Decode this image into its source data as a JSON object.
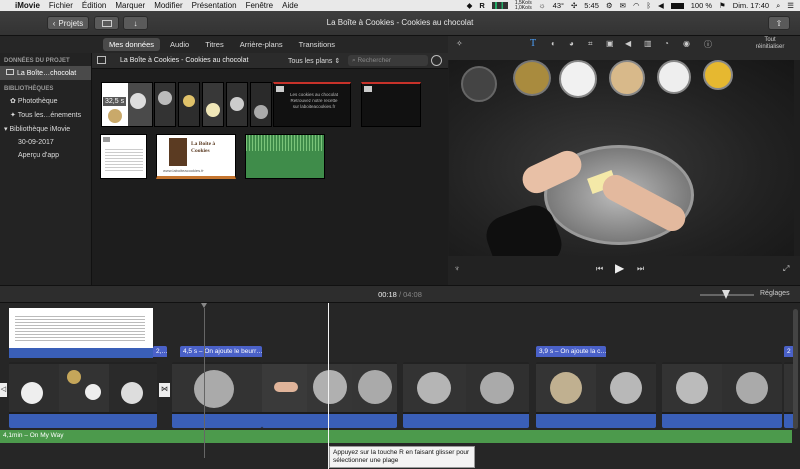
{
  "menubar": {
    "items": [
      "iMovie",
      "Fichier",
      "Édition",
      "Marquer",
      "Modifier",
      "Présentation",
      "Fenêtre",
      "Aide"
    ],
    "net_up": "1,5Ko/s",
    "net_down": "1,0Ko/s",
    "temp": "43°",
    "time": "5:45",
    "battery": "100 %",
    "clock": "Dim. 17:40"
  },
  "toolbar": {
    "projects_label": "Projets",
    "window_title": "La Boîte à Cookies - Cookies au chocolat"
  },
  "tabs": [
    {
      "label": "Mes données",
      "active": true
    },
    {
      "label": "Audio",
      "active": false
    },
    {
      "label": "Titres",
      "active": false
    },
    {
      "label": "Arrière-plans",
      "active": false
    },
    {
      "label": "Transitions",
      "active": false
    }
  ],
  "sidebar": {
    "project_header": "DONNÉES DU PROJET",
    "project_item": "La Boîte…chocolat",
    "libraries_header": "BIBLIOTHÈQUES",
    "items": [
      "Photothèque",
      "Tous les…énements",
      "Bibliothèque iMovie",
      "30-09-2017",
      "Aperçu d'app"
    ]
  },
  "browser": {
    "title": "La Boîte à Cookies - Cookies au chocolat",
    "filter": "Tous les plans",
    "search_placeholder": "Rechercher",
    "thumb_duration": "32,5 s",
    "logo_title": "La Boîte à Cookies",
    "logo_url": "www.laboiteacookies.fr",
    "title_card_lines": [
      "Les cookies au chocolat",
      "Retrouvez notre recette",
      "sur laboiteacookies.fr"
    ]
  },
  "viewer": {
    "reset_label": "Tout réinitialiser"
  },
  "timeline": {
    "current_time": "00:18",
    "total_time": "04:08",
    "settings_label": "Réglages",
    "clip_labels": [
      "2,…",
      "4,5 s – On ajoute le beurr…",
      "3,9 s – On ajoute la c…",
      "2"
    ],
    "music_label": "4,1min – On My Way",
    "tooltip": "Appuyez sur la touche R en faisant glisser pour sélectionner une plage"
  },
  "colors": {
    "accent_blue": "#3a5fb8",
    "audio_green": "#4c9a4c",
    "title_blue": "#4a61c8",
    "background": "#1e1e1e"
  }
}
